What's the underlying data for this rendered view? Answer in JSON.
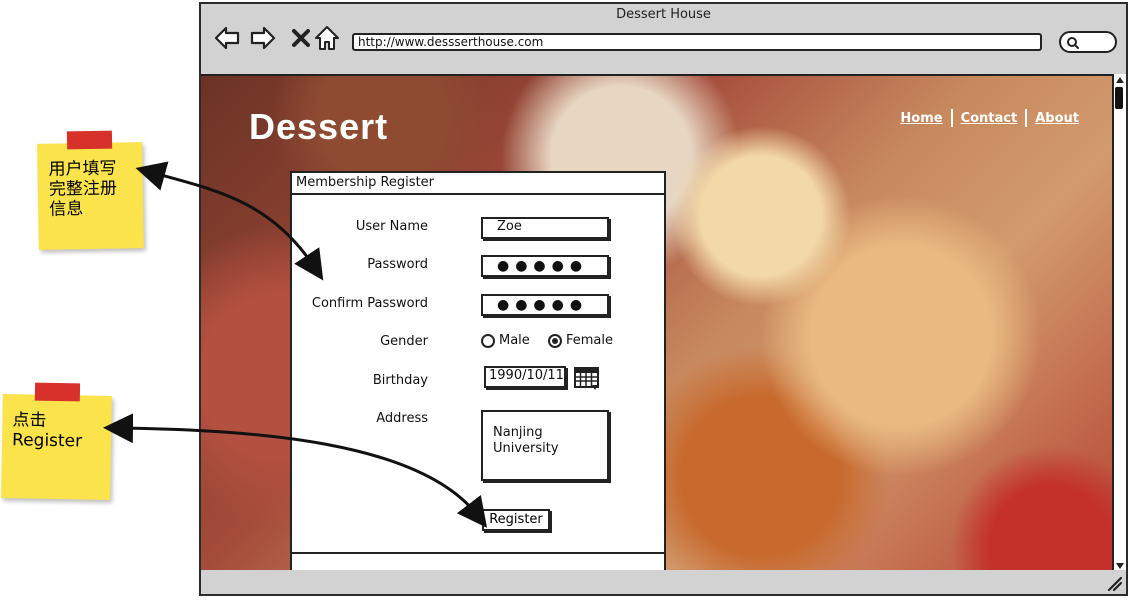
{
  "notes": [
    {
      "text": "用户填写\n完整注册\n信息"
    },
    {
      "text": "点击\nRegister"
    }
  ],
  "browser": {
    "title": "Dessert House",
    "url": "http://www.dessserthouse.com"
  },
  "site": {
    "title": "Dessert",
    "nav": [
      "Home",
      "Contact",
      "About"
    ]
  },
  "form": {
    "header": "Membership Register",
    "fields": {
      "username_label": "User Name",
      "username_value": "Zoe",
      "password_label": "Password",
      "password_value": "●●●●●",
      "confirm_label": "Confirm Password",
      "confirm_value": "●●●●●",
      "gender_label": "Gender",
      "gender_options": [
        "Male",
        "Female"
      ],
      "gender_selected": "Female",
      "birthday_label": "Birthday",
      "birthday_value": "1990/10/11",
      "address_label": "Address",
      "address_value": "Nanjing University"
    },
    "register_label": "Register"
  },
  "colors": {
    "note": "#fbe44b",
    "tape": "#d8312b",
    "chrome": "#d2d2d2"
  }
}
